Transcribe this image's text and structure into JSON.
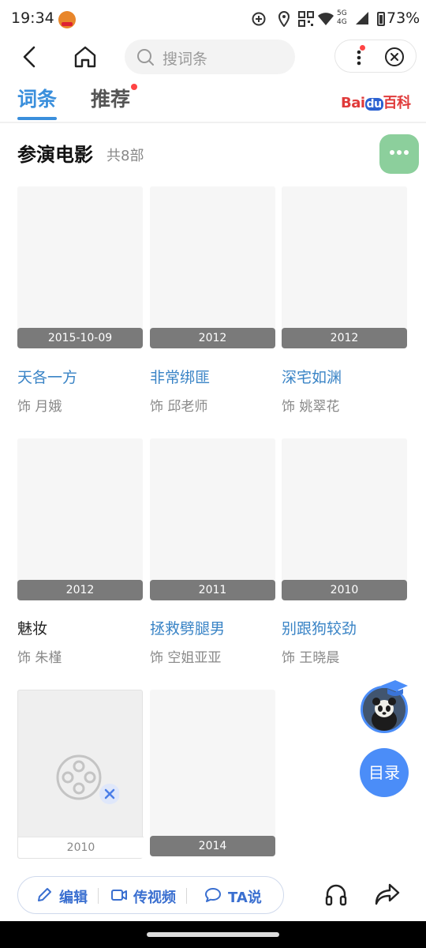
{
  "status_bar": {
    "time": "19:34",
    "network": "5G 4G",
    "battery": "73%"
  },
  "nav": {
    "search_placeholder": "搜词条"
  },
  "tabs": {
    "entry": "词条",
    "recommend": "推荐",
    "logo_bai": "Bai",
    "logo_du": "du",
    "logo_baike": "百科"
  },
  "section": {
    "title": "参演电影",
    "count": "共8部"
  },
  "movies": [
    {
      "date": "2015-10-09",
      "title": "天各一方",
      "role": "饰 月娥",
      "linked": true
    },
    {
      "date": "2012",
      "title": "非常绑匪",
      "role": "饰 邱老师",
      "linked": true
    },
    {
      "date": "2012",
      "title": "深宅如渊",
      "role": "饰 姚翠花",
      "linked": true
    },
    {
      "date": "2012",
      "title": "魅妆",
      "role": "饰 朱槿",
      "linked": false
    },
    {
      "date": "2011",
      "title": "拯救劈腿男",
      "role": "饰 空姐亚亚",
      "linked": true
    },
    {
      "date": "2010",
      "title": "别跟狗较劲",
      "role": "饰 王晓晨",
      "linked": true
    },
    {
      "date": "2010"
    },
    {
      "date": "2014"
    }
  ],
  "floating": {
    "toc_label": "目录"
  },
  "bottom_bar": {
    "edit_label": "编辑",
    "video_label": "传视频",
    "ta_label": "TA说"
  },
  "icons": {
    "accent": "#3a8fdc",
    "chat_button": "#8ccf9c",
    "toc_button": "#4b8df8"
  }
}
